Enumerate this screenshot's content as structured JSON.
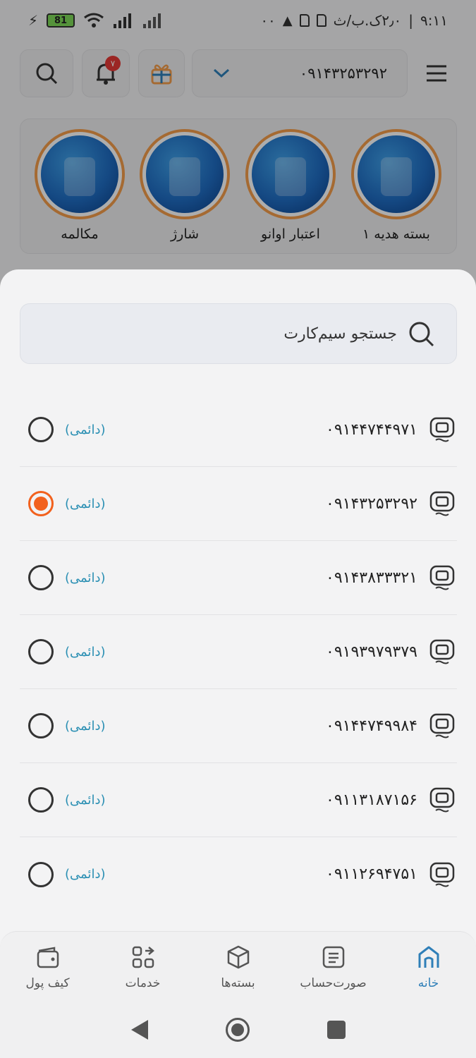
{
  "status_bar": {
    "time": "۹:۱۱",
    "network_speed": "۲٫۰ک.ب/ث",
    "battery": "81",
    "extra": "۰۰"
  },
  "header": {
    "phone_number": "۰۹۱۴۳۲۵۳۲۹۲",
    "notification_count": "۷"
  },
  "stories": [
    {
      "label": "بسته هدیه ۱"
    },
    {
      "label": "اعتبار اوانو"
    },
    {
      "label": "شارژ"
    },
    {
      "label": "مکالمه"
    }
  ],
  "sheet": {
    "search_placeholder": "جستجو سیم‌کارت",
    "sims": [
      {
        "number": "۰۹۱۴۴۷۴۴۹۷۱",
        "type": "(دائمی)",
        "selected": false
      },
      {
        "number": "۰۹۱۴۳۲۵۳۲۹۲",
        "type": "(دائمی)",
        "selected": true
      },
      {
        "number": "۰۹۱۴۳۸۳۳۳۲۱",
        "type": "(دائمی)",
        "selected": false
      },
      {
        "number": "۰۹۱۹۳۹۷۹۳۷۹",
        "type": "(دائمی)",
        "selected": false
      },
      {
        "number": "۰۹۱۴۴۷۴۹۹۸۴",
        "type": "(دائمی)",
        "selected": false
      },
      {
        "number": "۰۹۱۱۳۱۸۷۱۵۶",
        "type": "(دائمی)",
        "selected": false
      },
      {
        "number": "۰۹۱۱۲۶۹۴۷۵۱",
        "type": "(دائمی)",
        "selected": false
      }
    ]
  },
  "bottom_nav": {
    "home": "خانه",
    "bill": "صورت‌حساب",
    "packages": "بسته‌ها",
    "services": "خدمات",
    "wallet": "کیف پول"
  },
  "colors": {
    "accent_orange": "#f2611d",
    "accent_blue": "#2f7fb8",
    "sim_type": "#2a8fb3"
  }
}
